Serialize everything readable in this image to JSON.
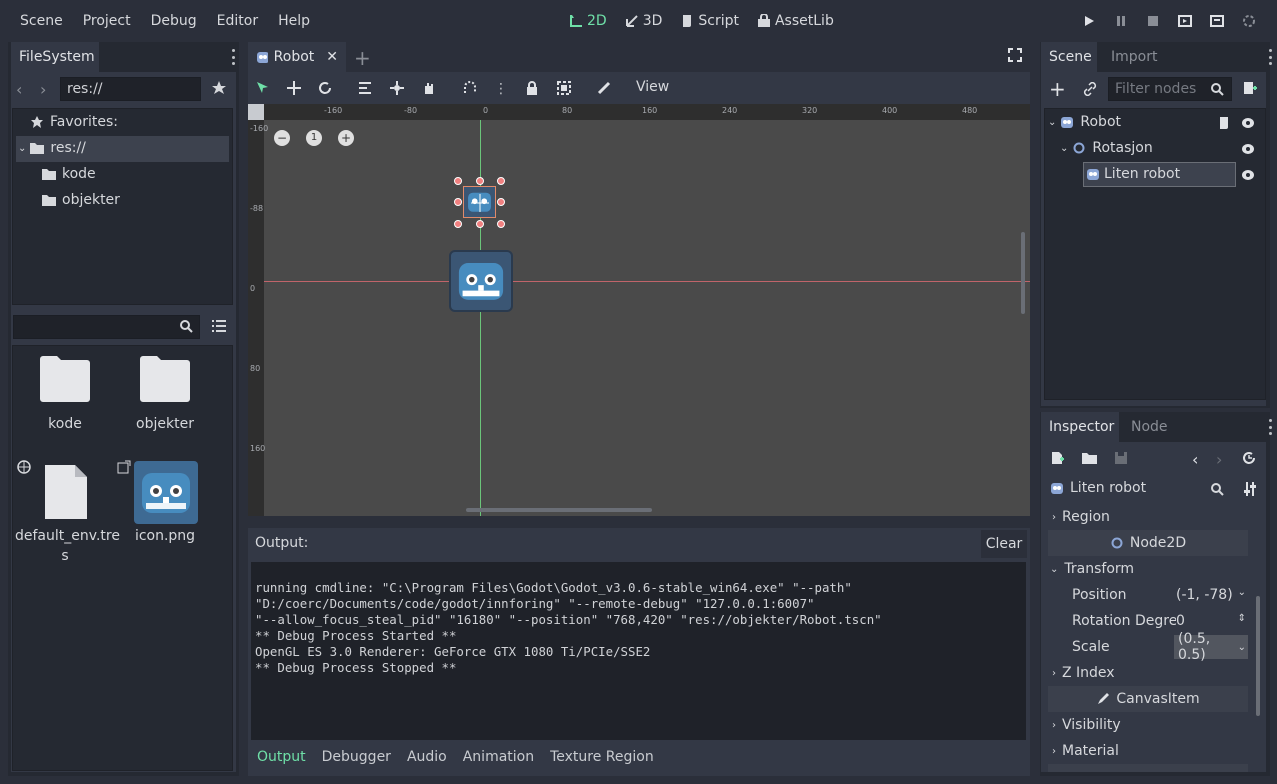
{
  "menu": [
    "Scene",
    "Project",
    "Debug",
    "Editor",
    "Help"
  ],
  "workspaces": {
    "d2": "2D",
    "d3": "3D",
    "script": "Script",
    "assetlib": "AssetLib"
  },
  "filesystem": {
    "tab": "FileSystem",
    "path": "res://",
    "favorites": "Favorites:",
    "tree": {
      "root": "res://",
      "kode": "kode",
      "objekter": "objekter"
    },
    "files": {
      "kode": "kode",
      "objekter": "objekter",
      "env1": "default_env.tre",
      "env2": "s",
      "icon": "icon.png"
    }
  },
  "editor": {
    "tab": "Robot",
    "view_menu": "View",
    "zoom_reset": "1",
    "ruler_x": [
      "-160",
      "-80",
      "0",
      "80",
      "160",
      "240",
      "320",
      "400",
      "480"
    ],
    "ruler_y": [
      "-160",
      "-88",
      "0",
      "80",
      "160"
    ]
  },
  "output": {
    "title": "Output:",
    "clear": "Clear",
    "lines": [
      "running cmdline: \"C:\\Program Files\\Godot\\Godot_v3.0.6-stable_win64.exe\" \"--path\"",
      "\"D:/coerc/Documents/code/godot/innforing\" \"--remote-debug\" \"127.0.0.1:6007\"",
      "\"--allow_focus_steal_pid\" \"16180\" \"--position\" \"768,420\" \"res://objekter/Robot.tscn\"",
      "** Debug Process Started **",
      "OpenGL ES 3.0 Renderer: GeForce GTX 1080 Ti/PCIe/SSE2",
      "** Debug Process Stopped **"
    ],
    "tabs": [
      "Output",
      "Debugger",
      "Audio",
      "Animation",
      "Texture Region"
    ]
  },
  "scene": {
    "tab": "Scene",
    "tab2": "Import",
    "filter_placeholder": "Filter nodes",
    "nodes": {
      "robot": "Robot",
      "rotasjon": "Rotasjon",
      "liten": "Liten robot"
    }
  },
  "inspector": {
    "tab": "Inspector",
    "tab2": "Node",
    "object": "Liten robot",
    "region": "Region",
    "node2d": "Node2D",
    "transform": "Transform",
    "position_label": "Position",
    "position_value": "(-1, -78)",
    "rotation_label": "Rotation Degre",
    "rotation_value": "0",
    "scale_label": "Scale",
    "scale_value": "(0.5, 0.5)",
    "zindex": "Z Index",
    "canvasitem": "CanvasItem",
    "visibility": "Visibility",
    "material": "Material"
  },
  "colors": {
    "accent": "#6fe0a8",
    "godot_blue": "#478cbf"
  }
}
